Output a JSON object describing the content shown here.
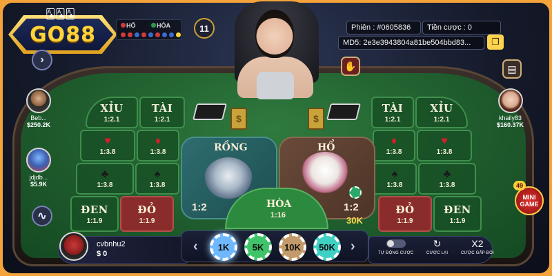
{
  "brand": {
    "logo_text": "GO88"
  },
  "road": {
    "tiger_label": "HỔ",
    "tie_label": "HÒA"
  },
  "round": {
    "number": "11"
  },
  "session": {
    "session_label": "Phiên : #0605836",
    "bet_label": "Tiền cược : 0",
    "md5_label": "MD5: 2e3e3943804a81be504bbd83..."
  },
  "table": {
    "left": {
      "xiu": {
        "label": "XỈU",
        "odd": "1:2.1"
      },
      "tai": {
        "label": "TÀI",
        "odd": "1:2.1"
      },
      "hearts": "1:3.8",
      "diamonds": "1:3.8",
      "clubs": "1:3.8",
      "spades": "1:3.8",
      "den": {
        "label": "ĐEN",
        "odd": "1:1.9"
      },
      "do": {
        "label": "ĐỎ",
        "odd": "1:1.9"
      }
    },
    "right": {
      "tai": {
        "label": "TÀI",
        "odd": "1:2.1"
      },
      "xiu": {
        "label": "XỈU",
        "odd": "1:2.1"
      },
      "diamonds": "1:3.8",
      "hearts": "1:3.8",
      "spades": "1:3.8",
      "clubs": "1:3.8",
      "do": {
        "label": "ĐỎ",
        "odd": "1:1.9"
      },
      "den": {
        "label": "ĐEN",
        "odd": "1:1.9"
      }
    },
    "dragon": {
      "label": "RỒNG",
      "odd": "1:2"
    },
    "tiger": {
      "label": "HỔ",
      "odd": "1:2",
      "bet": "30K"
    },
    "tie": {
      "label": "HÒA",
      "odd": "1:16"
    }
  },
  "players": [
    {
      "name": "Beb...",
      "money": "$250.2K"
    },
    {
      "name": "jdjdb...",
      "money": "$5.9K"
    },
    {
      "name": "khaily83",
      "money": "$160.37K"
    }
  ],
  "mini_game": {
    "count": "49",
    "line1": "MINI",
    "line2": "GAME"
  },
  "me": {
    "name": "cvbnhu2",
    "money": "$ 0"
  },
  "chips": [
    "1K",
    "5K",
    "10K",
    "50K"
  ],
  "controls": {
    "auto_bet": "TỰ ĐỘNG CƯỢC",
    "rebet": "CƯỢC LẠI",
    "double_icon": "X2",
    "double": "CƯỢC GẤP ĐÔI"
  },
  "colors": {
    "accent": "#ffd43b",
    "felt": "#1e5a2c",
    "red_zone": "#8a2c2c"
  }
}
